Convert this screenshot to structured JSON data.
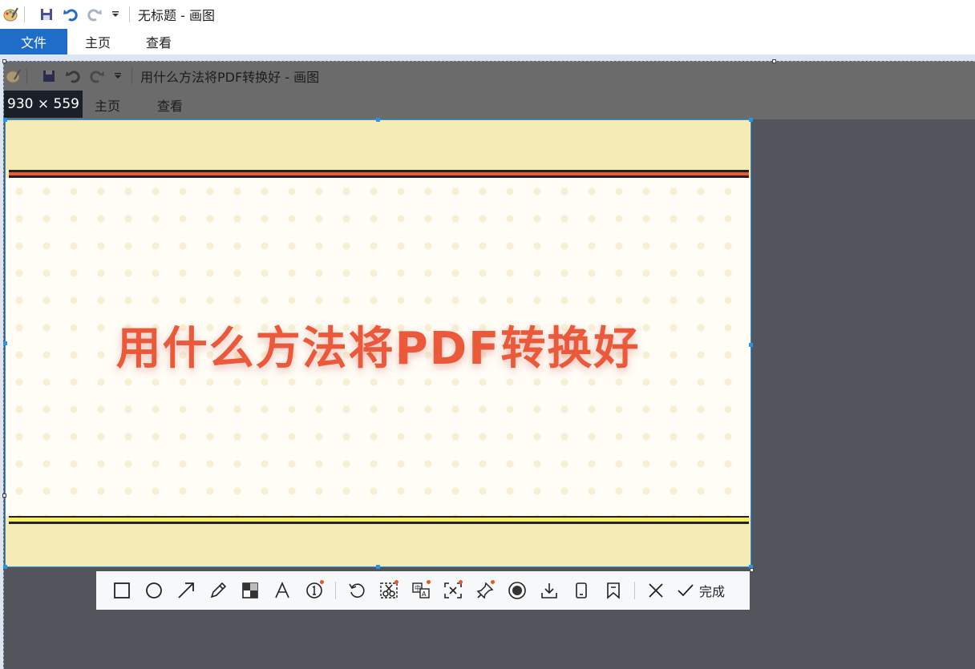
{
  "outer_window": {
    "title": "无标题 - 画图",
    "tabs": [
      {
        "label": "文件",
        "active": true
      },
      {
        "label": "主页",
        "active": false
      },
      {
        "label": "查看",
        "active": false
      }
    ]
  },
  "captured_window": {
    "title": "用什么方法将PDF转换好 - 画图",
    "tabs": [
      {
        "label": "文件"
      },
      {
        "label": "主页"
      },
      {
        "label": "查看"
      }
    ]
  },
  "selection": {
    "size_label": "930 × 559",
    "banner_text": "用什么方法将PDF转换好"
  },
  "toolbar": {
    "tools": [
      {
        "icon": "rectangle-icon",
        "label": "rectangle",
        "badge": false
      },
      {
        "icon": "ellipse-icon",
        "label": "ellipse",
        "badge": false
      },
      {
        "icon": "arrow-icon",
        "label": "arrow",
        "badge": false
      },
      {
        "icon": "pencil-icon",
        "label": "pencil",
        "badge": false
      },
      {
        "icon": "mosaic-icon",
        "label": "mosaic",
        "badge": false
      },
      {
        "icon": "text-icon",
        "label": "text",
        "badge": false
      },
      {
        "icon": "number-marker-icon",
        "label": "number-marker",
        "badge": true
      },
      {
        "icon": "undo-icon",
        "label": "undo",
        "badge": false
      },
      {
        "icon": "cutout-icon",
        "label": "cutout",
        "badge": true
      },
      {
        "icon": "translate-icon",
        "label": "translate",
        "badge": true
      },
      {
        "icon": "ocr-icon",
        "label": "ocr",
        "badge": true
      },
      {
        "icon": "pin-icon",
        "label": "pin",
        "badge": true
      },
      {
        "icon": "record-icon",
        "label": "record",
        "badge": false
      },
      {
        "icon": "download-icon",
        "label": "download",
        "badge": false
      },
      {
        "icon": "phone-icon",
        "label": "phone",
        "badge": false
      },
      {
        "icon": "bookmark-icon",
        "label": "bookmark",
        "badge": false
      }
    ],
    "cancel_icon": "close-icon",
    "done_label": "完成"
  },
  "colors": {
    "accent": "#1e6ec9",
    "selection_border": "#2a93e6",
    "banner_red": "#ea5a3a",
    "banner_yellow": "#f4eab3",
    "badge_dot": "#e35a2b"
  }
}
